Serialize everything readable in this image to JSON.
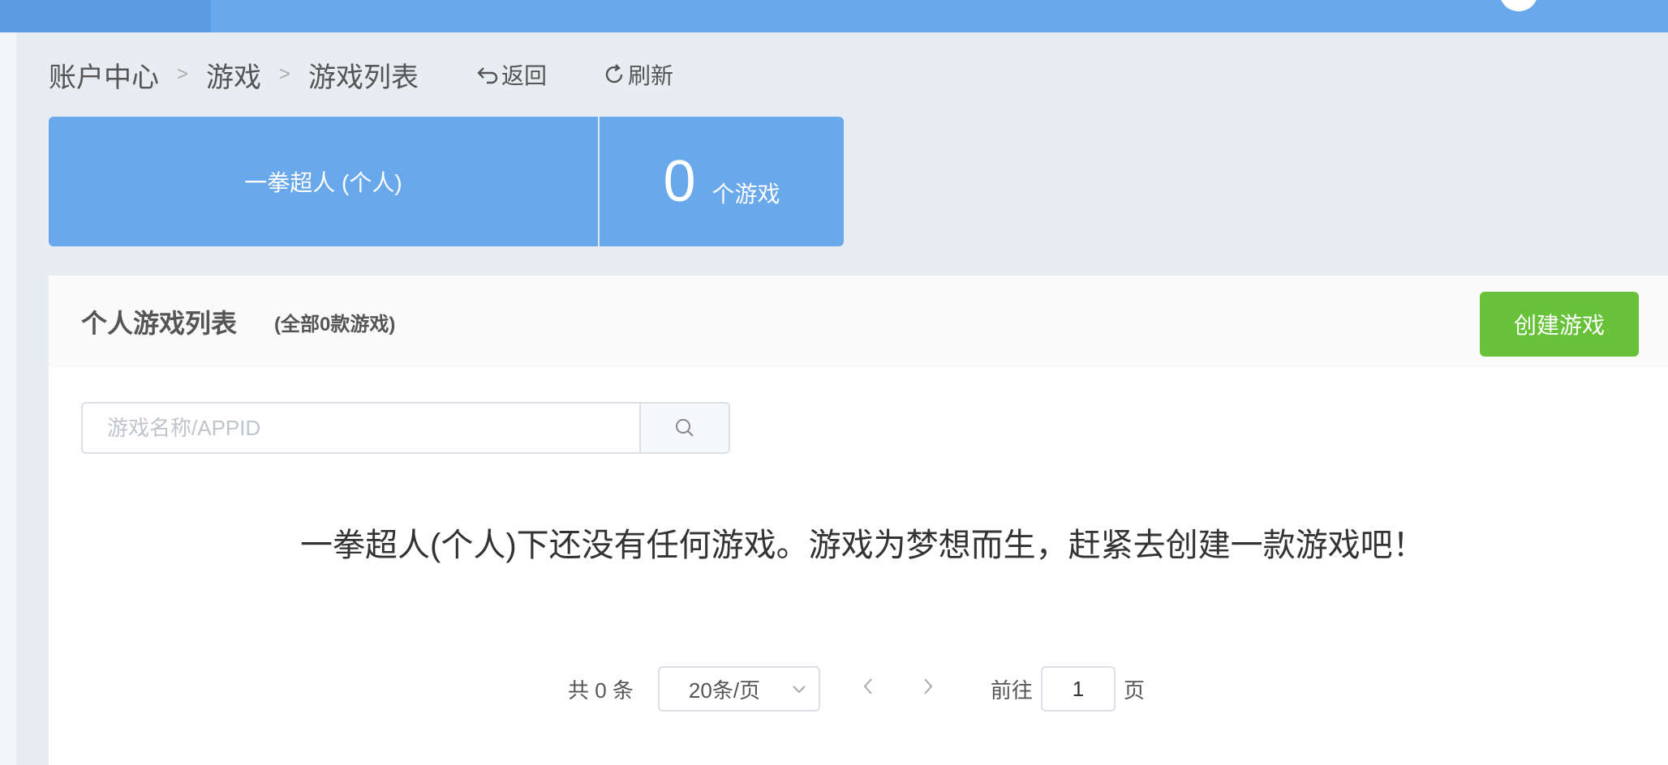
{
  "breadcrumb": {
    "items": [
      "账户中心",
      "游戏",
      "游戏列表"
    ],
    "separator": ">",
    "back_label": "返回",
    "refresh_label": "刷新"
  },
  "summary": {
    "owner": "一拳超人 (个人)",
    "count": "0",
    "unit": "个游戏"
  },
  "panel": {
    "title": "个人游戏列表",
    "subtitle": "(全部0款游戏)",
    "create_label": "创建游戏"
  },
  "search": {
    "placeholder": "游戏名称/APPID",
    "value": ""
  },
  "empty_message": "一拳超人(个人)下还没有任何游戏。游戏为梦想而生，赶紧去创建一款游戏吧！",
  "pagination": {
    "total_text": "共 0 条",
    "page_size": "20条/页",
    "goto_label": "前往",
    "current_page": "1",
    "page_unit": "页"
  },
  "colors": {
    "topbar": "#69a8ea",
    "summary_bg": "#69a8ea",
    "create_button": "#67c23a",
    "page_bg": "#e8edf1"
  }
}
